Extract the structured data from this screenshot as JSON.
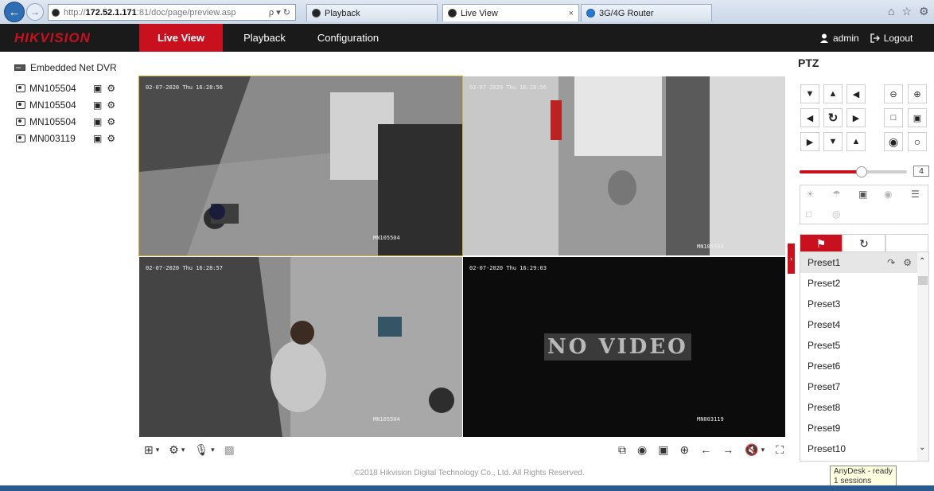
{
  "browser": {
    "url_prefix": "http://",
    "url_host": "172.52.1.171",
    "url_rest": ":81/doc/page/preview.asp",
    "url_icons": "ρ ▾ ↻",
    "tabs": [
      {
        "label": "Playback",
        "active": false
      },
      {
        "label": "Live View",
        "active": true,
        "close": "×"
      },
      {
        "label": "3G/4G Router",
        "active": false
      }
    ],
    "right_icons": [
      "⌂",
      "☆",
      "⚙"
    ]
  },
  "header": {
    "logo": "HIKVISION",
    "menu": [
      "Live View",
      "Playback",
      "Configuration"
    ],
    "active_menu": "Live View",
    "user": "admin",
    "logout": "Logout",
    "accent_color": "#c8101e"
  },
  "tree": {
    "root": "Embedded Net DVR",
    "cameras": [
      "MN105504",
      "MN105504",
      "MN105504",
      "MN003119"
    ]
  },
  "videos": [
    {
      "time": "02-07-2020 Thu 16:28:56",
      "name": "MN105504",
      "selected": true
    },
    {
      "time": "02-07-2020 Thu 16:28:56",
      "name": "MN105504",
      "selected": false
    },
    {
      "time": "02-07-2020 Thu 16:28:57",
      "name": "MN105504",
      "selected": false
    },
    {
      "time": "02-07-2020 Thu 16:29:03",
      "name": "MN003119",
      "selected": false,
      "status": "NO VIDEO"
    }
  ],
  "toolbar": {
    "left": [
      "layout-icon",
      "ptz-icon",
      "microphone-icon",
      "zoom-out-icon"
    ],
    "right": [
      "capture-icon",
      "camera-icon",
      "record-icon",
      "digital-zoom-icon",
      "prev-page-icon",
      "next-page-icon",
      "volume-icon",
      "fullscreen-icon"
    ]
  },
  "footer": {
    "copyright": "©2018 Hikvision Digital Technology Co., Ltd. All Rights Reserved."
  },
  "ptz": {
    "title": "PTZ",
    "speed": 4,
    "speed_max": 7,
    "presets": [
      "Preset1",
      "Preset2",
      "Preset3",
      "Preset4",
      "Preset5",
      "Preset6",
      "Preset7",
      "Preset8",
      "Preset9",
      "Preset10"
    ],
    "selected_preset": "Preset1"
  },
  "tooltip": {
    "line1": "AnyDesk - ready",
    "line2": "1 sessions"
  }
}
